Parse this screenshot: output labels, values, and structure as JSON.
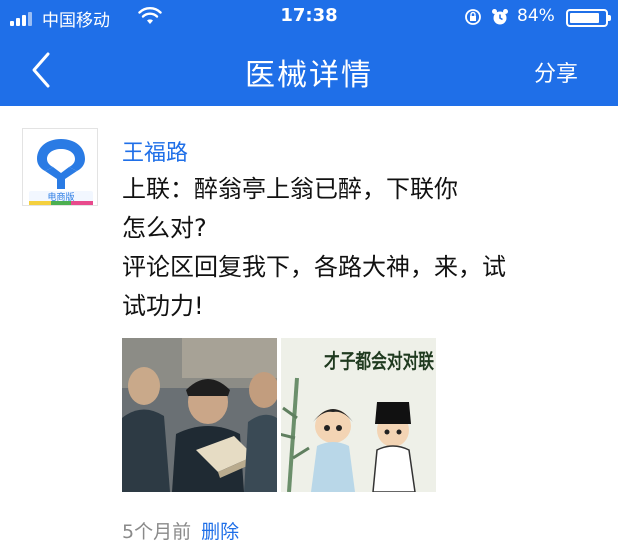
{
  "status_bar": {
    "carrier": "中国移动",
    "time": "17:38",
    "battery_percent": "84%",
    "battery_level": 0.84,
    "icons": [
      "signal-icon",
      "wifi-icon",
      "rotation-lock-icon",
      "alarm-icon",
      "battery-icon"
    ]
  },
  "nav": {
    "title": "医械详情",
    "share_label": "分享",
    "back_icon": "chevron-left-icon"
  },
  "post": {
    "avatar_badge": "电商版",
    "author": "王福路",
    "lines": [
      "上联：醉翁亭上翁已醉，下联你",
      "怎么对?",
      "评论区回复我下，各路大神，来，试",
      "试功力!"
    ],
    "images": [
      {
        "name": "men-reading-book-photo"
      },
      {
        "name": "cartoon-couplet-illustration",
        "caption": "才子都会对对联"
      }
    ],
    "time_ago": "5个月前",
    "delete_label": "删除"
  },
  "colors": {
    "brand_blue": "#1f6fe8",
    "meta_gray": "#8a8a8a"
  }
}
